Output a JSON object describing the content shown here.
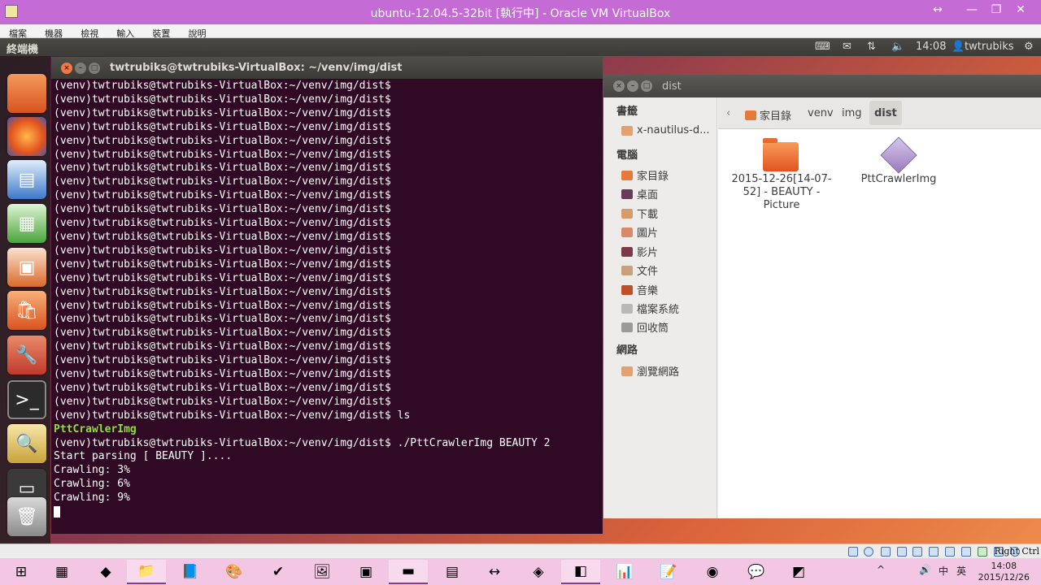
{
  "host_window": {
    "title": "ubuntu-12.04.5-32bit [執行中] - Oracle VM VirtualBox",
    "buttons": {
      "resize": "↔",
      "minimize": "—",
      "maximize": "❐",
      "close": "✕"
    }
  },
  "vbox_menu": [
    "檔案",
    "機器",
    "檢視",
    "輸入",
    "裝置",
    "說明"
  ],
  "ubuntu_panel": {
    "app_title": "終端機",
    "time": "14:08",
    "user": "twtrubiks",
    "icons": [
      "keyboard-icon",
      "mail-icon",
      "network-icon",
      "volume-icon",
      "user-icon",
      "gear-icon"
    ]
  },
  "launcher": {
    "items": [
      "files",
      "firefox",
      "writer",
      "calc",
      "impress",
      "software-center",
      "settings",
      "terminal",
      "image-viewer",
      "workspaces",
      "trash"
    ]
  },
  "terminal": {
    "title": "twtrubiks@twtrubiks-VirtualBox: ~/venv/img/dist",
    "lines": [
      "(venv)twtrubiks@twtrubiks-VirtualBox:~/venv/img/dist$",
      "(venv)twtrubiks@twtrubiks-VirtualBox:~/venv/img/dist$",
      "(venv)twtrubiks@twtrubiks-VirtualBox:~/venv/img/dist$",
      "(venv)twtrubiks@twtrubiks-VirtualBox:~/venv/img/dist$",
      "(venv)twtrubiks@twtrubiks-VirtualBox:~/venv/img/dist$",
      "(venv)twtrubiks@twtrubiks-VirtualBox:~/venv/img/dist$",
      "(venv)twtrubiks@twtrubiks-VirtualBox:~/venv/img/dist$",
      "(venv)twtrubiks@twtrubiks-VirtualBox:~/venv/img/dist$",
      "(venv)twtrubiks@twtrubiks-VirtualBox:~/venv/img/dist$",
      "(venv)twtrubiks@twtrubiks-VirtualBox:~/venv/img/dist$",
      "(venv)twtrubiks@twtrubiks-VirtualBox:~/venv/img/dist$",
      "(venv)twtrubiks@twtrubiks-VirtualBox:~/venv/img/dist$",
      "(venv)twtrubiks@twtrubiks-VirtualBox:~/venv/img/dist$",
      "(venv)twtrubiks@twtrubiks-VirtualBox:~/venv/img/dist$",
      "(venv)twtrubiks@twtrubiks-VirtualBox:~/venv/img/dist$",
      "(venv)twtrubiks@twtrubiks-VirtualBox:~/venv/img/dist$",
      "(venv)twtrubiks@twtrubiks-VirtualBox:~/venv/img/dist$",
      "(venv)twtrubiks@twtrubiks-VirtualBox:~/venv/img/dist$",
      "(venv)twtrubiks@twtrubiks-VirtualBox:~/venv/img/dist$",
      "(venv)twtrubiks@twtrubiks-VirtualBox:~/venv/img/dist$",
      "(venv)twtrubiks@twtrubiks-VirtualBox:~/venv/img/dist$",
      "(venv)twtrubiks@twtrubiks-VirtualBox:~/venv/img/dist$",
      "(venv)twtrubiks@twtrubiks-VirtualBox:~/venv/img/dist$",
      "(venv)twtrubiks@twtrubiks-VirtualBox:~/venv/img/dist$",
      "(venv)twtrubiks@twtrubiks-VirtualBox:~/venv/img/dist$ ls",
      "PttCrawlerImg",
      "(venv)twtrubiks@twtrubiks-VirtualBox:~/venv/img/dist$ ./PttCrawlerImg BEAUTY 2",
      "Start parsing [ BEAUTY ]....",
      "Crawling: 3%",
      "Crawling: 6%",
      "Crawling: 9%"
    ],
    "highlight_line": "PttCrawlerImg"
  },
  "file_manager": {
    "title": "dist",
    "sections": {
      "bookmarks": "書籤",
      "computer": "電腦",
      "network": "網路"
    },
    "bookmark_items": [
      "x-nautilus-d..."
    ],
    "computer_items": [
      "家目錄",
      "桌面",
      "下載",
      "圖片",
      "影片",
      "文件",
      "音樂",
      "檔案系統",
      "回收筒"
    ],
    "network_items": [
      "瀏覽網路"
    ],
    "breadcrumb": [
      "家目錄",
      "venv",
      "img",
      "dist"
    ],
    "files": [
      {
        "name_lines": [
          "2015-12-26[14-07-",
          "52] - BEAUTY -",
          "Picture"
        ],
        "icon": "folder-icon"
      },
      {
        "name_lines": [
          "PttCrawlerImg"
        ],
        "icon": "package-icon"
      }
    ]
  },
  "vbox_status": {
    "host_key": "Right Ctrl"
  },
  "taskbar": {
    "tray": [
      "^",
      "🔊",
      "中",
      "英"
    ],
    "clock_time": "14:08",
    "clock_date": "2015/12/26"
  }
}
